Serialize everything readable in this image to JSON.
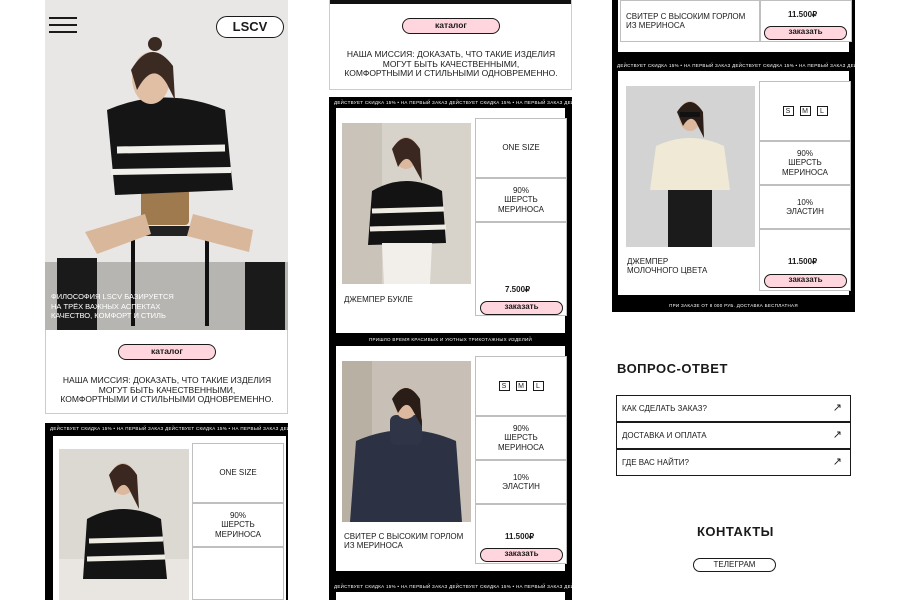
{
  "hero": {
    "logo": "LSCV",
    "caption_lines": [
      "ФИЛОСОФИЯ LSCV БАЗИРУЕТСЯ",
      "НА ТРЁХ ВАЖНЫХ АСПЕКТАХ",
      "КАЧЕСТВО, КОМФОРТ И СТИЛЬ"
    ]
  },
  "catalog_label": "каталог",
  "mission_lines": [
    "НАША МИССИЯ: ДОКАЗАТЬ, ЧТО ТАКИЕ ИЗДЕЛИЯ",
    "МОГУТ БЫТЬ КАЧЕСТВЕННЫМИ,",
    "КОМФОРТНЫМИ И СТИЛЬНЫМИ ОДНОВРЕМЕННО."
  ],
  "ticker": {
    "discount": "ДЕЙСТВУЕТ СКИДКА 15%  •  НА ПЕРВЫЙ ЗАКАЗ ДЕЙСТВУЕТ СКИДКА 15%  •  НА ПЕРВЫЙ ЗАКАЗ ДЕЙСТВУЕТ СКИДКА 15%",
    "knit": "ПРИШЛО ВРЕМЯ КРАСИВЫХ И УЮТНЫХ ТРИКОТАЖНЫХ ИЗДЕЛИЙ",
    "delivery": "ПРИ ЗАКАЗЕ ОТ 8 000 РУБ. ДОСТАВКА БЕСПЛАТНАЯ"
  },
  "sizes": [
    "S",
    "M",
    "L"
  ],
  "order_label": "заказать",
  "products": {
    "boucle": {
      "name": "ДЖЕМПЕР БУКЛЕ",
      "size": "ONE SIZE",
      "composition_lines": [
        "90%",
        "ШЕРСТЬ",
        "МЕРИНОСА"
      ],
      "price": "7.500₽"
    },
    "turtleneck": {
      "name_lines": [
        "СВИТЕР С ВЫСОКИМ ГОРЛОМ",
        "ИЗ МЕРИНОСА"
      ],
      "wool_lines": [
        "90%",
        "ШЕРСТЬ",
        "МЕРИНОСА"
      ],
      "elastane_lines": [
        "10%",
        "ЭЛАСТИН"
      ],
      "price": "11.500₽"
    },
    "milky": {
      "name_lines": [
        "ДЖЕМПЕР",
        "МОЛОЧНОГО ЦВЕТА"
      ],
      "wool_lines": [
        "90%",
        "ШЕРСТЬ",
        "МЕРИНОСА"
      ],
      "elastane_lines": [
        "10%",
        "ЭЛАСТИН"
      ],
      "price": "11.500₽"
    }
  },
  "faq": {
    "title": "ВОПРОС-ОТВЕТ",
    "items": [
      "КАК СДЕЛАТЬ ЗАКАЗ?",
      "ДОСТАВКА И ОПЛАТА",
      "ГДЕ ВАС НАЙТИ?"
    ]
  },
  "contacts": {
    "title": "КОНТАКТЫ",
    "telegram": "ТЕЛЕГРАМ"
  },
  "colors": {
    "accent_pink": "#ffd6dd",
    "frame": "#000000",
    "text": "#1a1a1a"
  }
}
